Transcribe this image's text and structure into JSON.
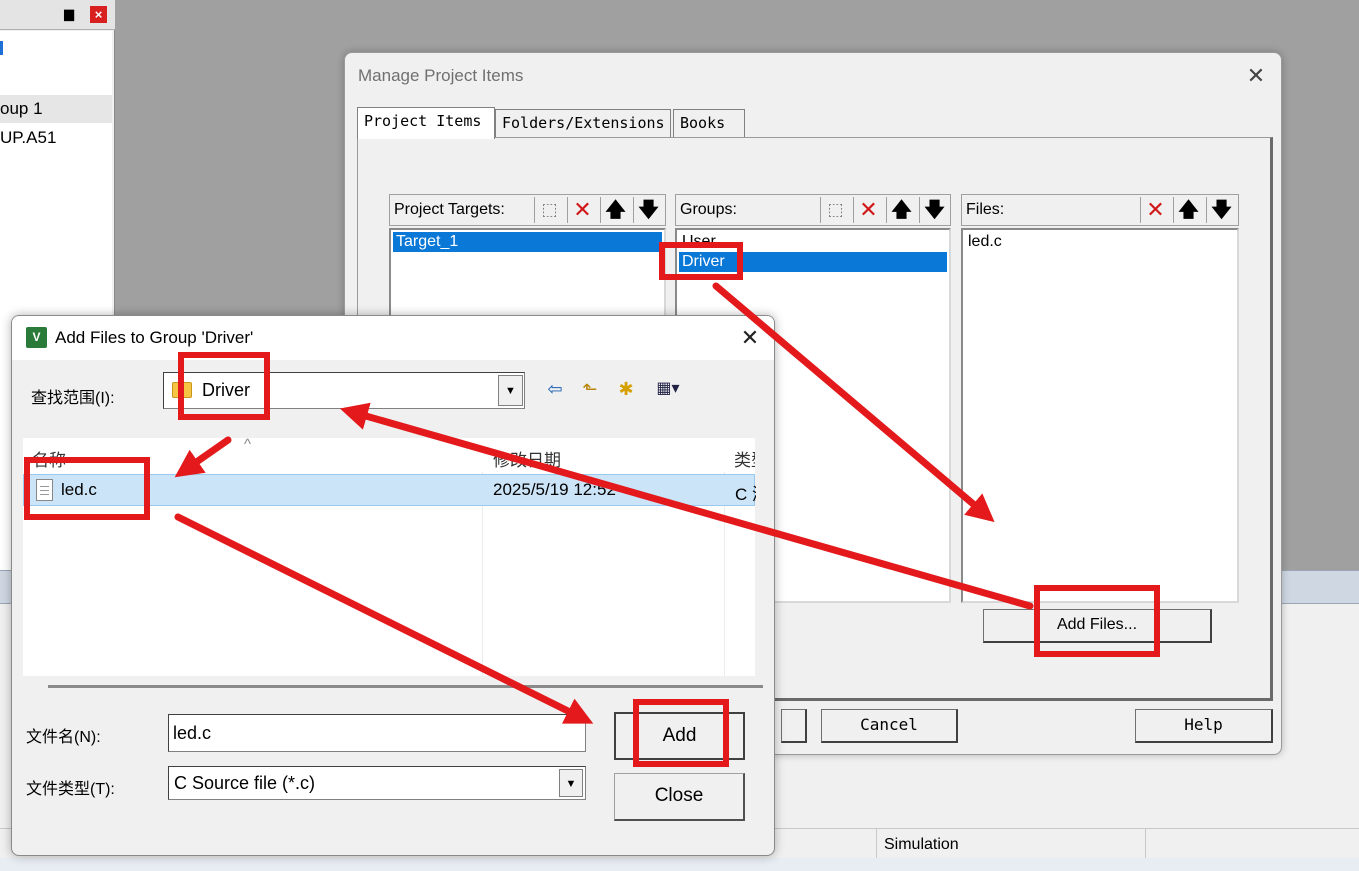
{
  "ide": {
    "pin_glyph": "▆",
    "close_glyph": "×",
    "tree_group": "oup 1",
    "tree_file": "UP.A51",
    "status_simulation": "Simulation"
  },
  "manage_dialog": {
    "title": "Manage Project Items",
    "close_glyph": "✕",
    "tabs": [
      "Project Items",
      "Folders/Extensions",
      "Books"
    ],
    "targets": {
      "label": "Project Targets:",
      "items": [
        "Target_1"
      ]
    },
    "groups": {
      "label": "Groups:",
      "items": [
        "User",
        "Driver"
      ]
    },
    "files": {
      "label": "Files:",
      "items": [
        "led.c"
      ]
    },
    "glyphs": {
      "new": "⬚",
      "delete": "✕",
      "up": "🡅",
      "down": "🡇"
    },
    "add_files_label": "Add Files...",
    "cancel_label": "Cancel",
    "help_label": "Help"
  },
  "add_files_dialog": {
    "title": "Add Files to Group 'Driver'",
    "app_icon_text": "V",
    "close_glyph": "✕",
    "look_in_label": "查找范围(I):",
    "look_in_value": "Driver",
    "toolbar": {
      "back": "⇦",
      "up": "⬑",
      "new_folder": "✱",
      "view": "▦▾"
    },
    "columns": {
      "name": "名称",
      "date": "修改日期",
      "type": "类型"
    },
    "sort_glyph": "^",
    "file": {
      "name": "led.c",
      "date": "2025/5/19 12:52",
      "type": "C 源文件"
    },
    "filename_label": "文件名(N):",
    "filename_value": "led.c",
    "filetype_label": "文件类型(T):",
    "filetype_value": "C Source file (*.c)",
    "add_label": "Add",
    "close_label": "Close"
  },
  "colors": {
    "annotation": "#e3191b",
    "selection": "#0a78d7",
    "file_row": "#cce4f7"
  }
}
